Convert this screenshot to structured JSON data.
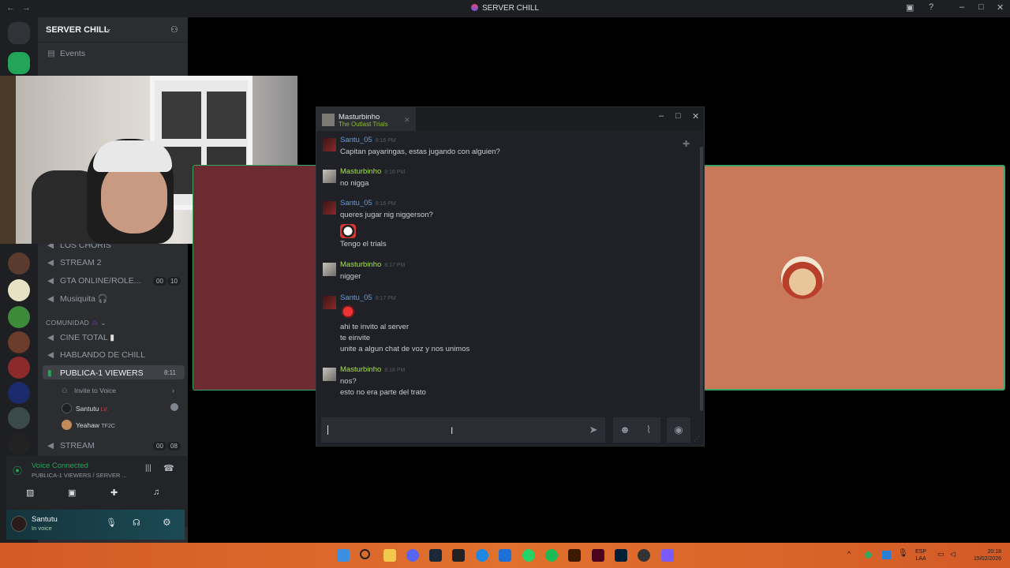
{
  "titlebar": {
    "title": "SERVER CHILL",
    "back": "←",
    "forward": "→"
  },
  "sidebar": {
    "server_name": "SERVER CHILL",
    "events_label": "Events",
    "channels": [
      {
        "label": "LOS CHORIS"
      },
      {
        "label": "STREAM 2"
      },
      {
        "label": "GTA ONLINE/ROLE...",
        "count_a": "00",
        "count_b": "10"
      },
      {
        "label": "Musiquita 🎧"
      }
    ],
    "category": "COMUNIDAD",
    "community_channels": [
      {
        "label": "CINE TOTAL"
      },
      {
        "label": "HABLANDO DE CHILL"
      },
      {
        "label": "PUBLICA-1 VIEWERS",
        "timer": "8:11"
      }
    ],
    "invite_label": "Invite to Voice",
    "voice_members": [
      {
        "name": "Santutu",
        "tag": "LV."
      },
      {
        "name": "Yeahaw",
        "tag": "TF2C"
      }
    ],
    "stream_channel": {
      "label": "STREAM",
      "count_a": "00",
      "count_b": "08"
    },
    "voice_status": {
      "title": "Voice Connected",
      "subtitle": "PUBLICA-1 VIEWERS / SERVER ..."
    },
    "user": {
      "name": "Santutu",
      "status": "In voice"
    }
  },
  "steam_chat": {
    "tab_name": "Masturbinho",
    "tab_game": "The Outlast Trials",
    "messages": [
      {
        "author": "Santu_05",
        "time": "8:16 PM",
        "lines": [
          "Capitan payaringas, estas jugando con alguien?"
        ]
      },
      {
        "author": "Masturbinho",
        "time": "8:16 PM",
        "lines": [
          "no nigga"
        ]
      },
      {
        "author": "Santu_05",
        "time": "8:16 PM",
        "lines": [
          "queres jugar nig niggerson?",
          "Tengo el trials"
        ]
      },
      {
        "author": "Masturbinho",
        "time": "8:17 PM",
        "lines": [
          "nigger"
        ]
      },
      {
        "author": "Santu_05",
        "time": "8:17 PM",
        "lines": [
          "ahi te invito al server",
          "te einvite",
          "unite a algun chat de voz y nos unimos"
        ]
      },
      {
        "author": "Masturbinho",
        "time": "8:18 PM",
        "lines": [
          "nos?",
          "esto no era parte del trato"
        ]
      }
    ],
    "input_value": ""
  },
  "taskbar": {
    "lang": "ESP",
    "lang2": "LAA",
    "time": "20:18",
    "date": "15/02/2026"
  },
  "colors": {
    "accent_green": "#3ba55d",
    "taskbar": "#d45a26",
    "steam_name_online": "#a6e04a",
    "steam_name_offline": "#6a9bd8"
  }
}
